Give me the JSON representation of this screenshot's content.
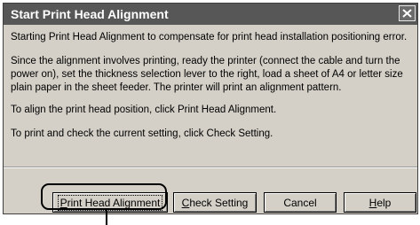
{
  "dialog": {
    "title": "Start Print Head Alignment",
    "close_label": "Close",
    "paragraphs": [
      "Starting Print Head Alignment to compensate for print head installation positioning error.",
      "Since the alignment involves printing, ready the printer (connect the cable and turn the power on), set the thickness selection lever to the right, load a sheet of A4 or letter size plain paper in the sheet feeder. The printer will print an alignment pattern.",
      "To align the print head position, click Print Head Alignment.",
      "To print and check the current setting, click Check Setting."
    ],
    "buttons": {
      "print_head_alignment": {
        "pre": "",
        "accel": "P",
        "post": "rint Head Alignment"
      },
      "check_setting": {
        "pre": "",
        "accel": "C",
        "post": "heck Setting"
      },
      "cancel": "Cancel",
      "help": {
        "pre": "",
        "accel": "H",
        "post": "elp"
      }
    }
  },
  "colors": {
    "titlebar": "#575757",
    "dialog_bg": "#d4d0c8",
    "text": "#000000"
  }
}
